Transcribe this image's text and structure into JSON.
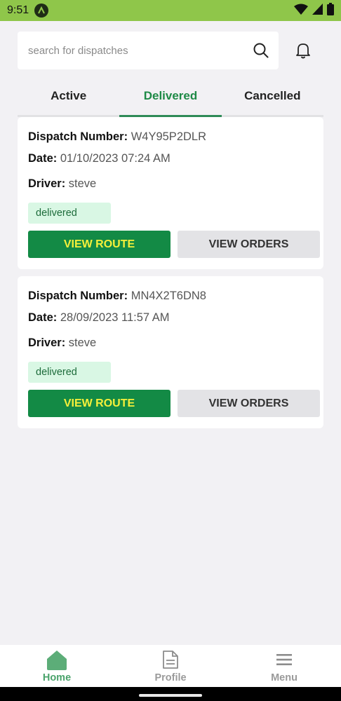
{
  "status_bar": {
    "time": "9:51",
    "icons": [
      "app-notification-icon",
      "wifi-icon",
      "signal-icon",
      "battery-icon"
    ]
  },
  "search": {
    "placeholder": "search for dispatches",
    "value": ""
  },
  "tabs": [
    {
      "label": "Active",
      "active": false
    },
    {
      "label": "Delivered",
      "active": true
    },
    {
      "label": "Cancelled",
      "active": false
    }
  ],
  "dispatches": [
    {
      "number_label": "Dispatch Number:",
      "number": "W4Y95P2DLR",
      "date_label": "Date:",
      "date": "01/10/2023 07:24 AM",
      "driver_label": "Driver:",
      "driver": "steve",
      "status": "delivered",
      "route_button": "VIEW ROUTE",
      "orders_button": "VIEW ORDERS"
    },
    {
      "number_label": "Dispatch Number:",
      "number": "MN4X2T6DN8",
      "date_label": "Date:",
      "date": "28/09/2023 11:57 AM",
      "driver_label": "Driver:",
      "driver": "steve",
      "status": "delivered",
      "route_button": "VIEW ROUTE",
      "orders_button": "VIEW ORDERS"
    }
  ],
  "bottom_nav": [
    {
      "label": "Home",
      "icon": "home-icon",
      "active": true
    },
    {
      "label": "Profile",
      "icon": "document-icon",
      "active": false
    },
    {
      "label": "Menu",
      "icon": "menu-icon",
      "active": false
    }
  ],
  "colors": {
    "status_bar": "#8fc64a",
    "accent_green": "#138a45",
    "active_tab": "#1e8a46",
    "route_text": "#f6f03a",
    "badge_bg": "#d9f7e4"
  }
}
